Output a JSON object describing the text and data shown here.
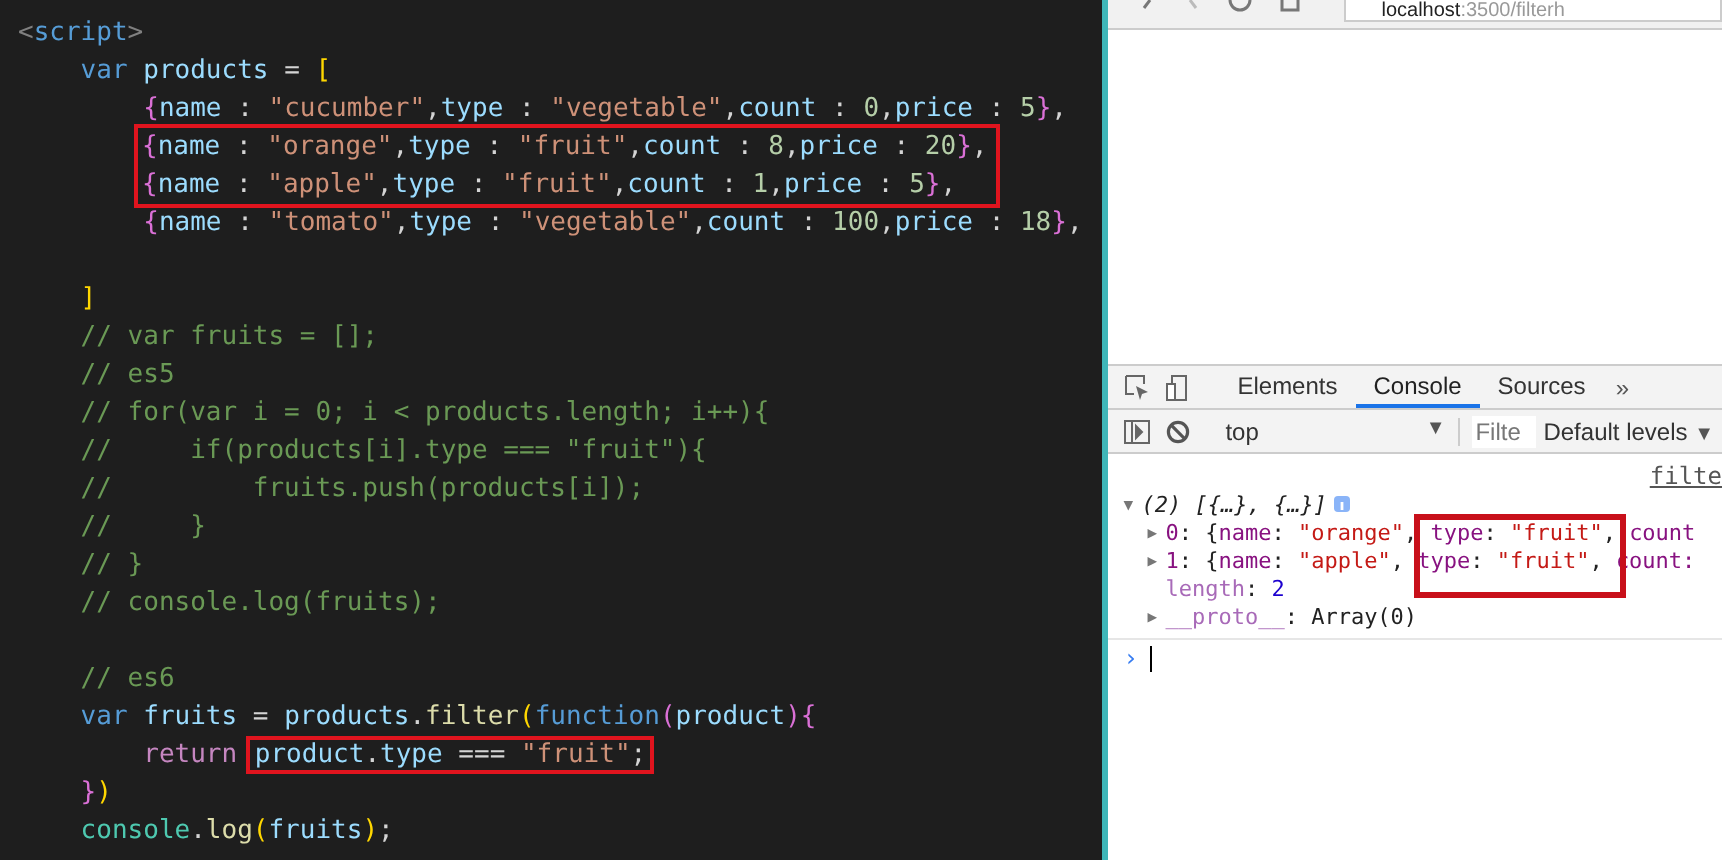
{
  "editor": {
    "lines": [
      {
        "kind": "line",
        "tokens": [
          {
            "kind": "angle",
            "text": "<"
          },
          {
            "kind": "tag",
            "text": "script"
          },
          {
            "kind": "angle",
            "text": ">"
          }
        ]
      },
      {
        "kind": "line",
        "tokens": [
          {
            "kind": "keyword",
            "text": "    var "
          },
          {
            "kind": "ident",
            "text": "products"
          },
          {
            "kind": "plain",
            "text": " = "
          },
          {
            "kind": "bracket1",
            "text": "["
          }
        ]
      },
      {
        "kind": "line",
        "tokens": [
          {
            "kind": "bracket2",
            "text": "        {"
          },
          {
            "kind": "ident",
            "text": "name"
          },
          {
            "kind": "plain",
            "text": " : "
          },
          {
            "kind": "string",
            "text": "\"cucumber\""
          },
          {
            "kind": "plain",
            "text": ","
          },
          {
            "kind": "ident",
            "text": "type"
          },
          {
            "kind": "plain",
            "text": " : "
          },
          {
            "kind": "string",
            "text": "\"vegetable\""
          },
          {
            "kind": "plain",
            "text": ","
          },
          {
            "kind": "ident",
            "text": "count"
          },
          {
            "kind": "plain",
            "text": " : "
          },
          {
            "kind": "number",
            "text": "0"
          },
          {
            "kind": "plain",
            "text": ","
          },
          {
            "kind": "ident",
            "text": "price"
          },
          {
            "kind": "plain",
            "text": " : "
          },
          {
            "kind": "number",
            "text": "5"
          },
          {
            "kind": "bracket2",
            "text": "}"
          },
          {
            "kind": "plain",
            "text": ","
          }
        ]
      },
      {
        "kind": "boxed",
        "lines": [
          {
            "tokens": [
              {
                "kind": "bracket2",
                "text": "{"
              },
              {
                "kind": "ident",
                "text": "name"
              },
              {
                "kind": "plain",
                "text": " : "
              },
              {
                "kind": "string",
                "text": "\"orange\""
              },
              {
                "kind": "plain",
                "text": ","
              },
              {
                "kind": "ident",
                "text": "type"
              },
              {
                "kind": "plain",
                "text": " : "
              },
              {
                "kind": "string",
                "text": "\"fruit\""
              },
              {
                "kind": "plain",
                "text": ","
              },
              {
                "kind": "ident",
                "text": "count"
              },
              {
                "kind": "plain",
                "text": " : "
              },
              {
                "kind": "number",
                "text": "8"
              },
              {
                "kind": "plain",
                "text": ","
              },
              {
                "kind": "ident",
                "text": "price"
              },
              {
                "kind": "plain",
                "text": " : "
              },
              {
                "kind": "number",
                "text": "20"
              },
              {
                "kind": "bracket2",
                "text": "}"
              },
              {
                "kind": "plain",
                "text": ","
              }
            ]
          },
          {
            "tokens": [
              {
                "kind": "bracket2",
                "text": "{"
              },
              {
                "kind": "ident",
                "text": "name"
              },
              {
                "kind": "plain",
                "text": " : "
              },
              {
                "kind": "string",
                "text": "\"apple\""
              },
              {
                "kind": "plain",
                "text": ","
              },
              {
                "kind": "ident",
                "text": "type"
              },
              {
                "kind": "plain",
                "text": " : "
              },
              {
                "kind": "string",
                "text": "\"fruit\""
              },
              {
                "kind": "plain",
                "text": ","
              },
              {
                "kind": "ident",
                "text": "count"
              },
              {
                "kind": "plain",
                "text": " : "
              },
              {
                "kind": "number",
                "text": "1"
              },
              {
                "kind": "plain",
                "text": ","
              },
              {
                "kind": "ident",
                "text": "price"
              },
              {
                "kind": "plain",
                "text": " : "
              },
              {
                "kind": "number",
                "text": "5"
              },
              {
                "kind": "bracket2",
                "text": "}"
              },
              {
                "kind": "plain",
                "text": ","
              }
            ]
          }
        ]
      },
      {
        "kind": "line",
        "tokens": [
          {
            "kind": "bracket2",
            "text": "        {"
          },
          {
            "kind": "ident",
            "text": "name"
          },
          {
            "kind": "plain",
            "text": " : "
          },
          {
            "kind": "string",
            "text": "\"tomato\""
          },
          {
            "kind": "plain",
            "text": ","
          },
          {
            "kind": "ident",
            "text": "type"
          },
          {
            "kind": "plain",
            "text": " : "
          },
          {
            "kind": "string",
            "text": "\"vegetable\""
          },
          {
            "kind": "plain",
            "text": ","
          },
          {
            "kind": "ident",
            "text": "count"
          },
          {
            "kind": "plain",
            "text": " : "
          },
          {
            "kind": "number",
            "text": "100"
          },
          {
            "kind": "plain",
            "text": ","
          },
          {
            "kind": "ident",
            "text": "price"
          },
          {
            "kind": "plain",
            "text": " : "
          },
          {
            "kind": "number",
            "text": "18"
          },
          {
            "kind": "bracket2",
            "text": "}"
          },
          {
            "kind": "plain",
            "text": ","
          }
        ]
      },
      {
        "kind": "line"
      },
      {
        "kind": "line",
        "tokens": [
          {
            "kind": "bracket1",
            "text": "    ]"
          }
        ]
      },
      {
        "kind": "line",
        "tokens": [
          {
            "kind": "comment",
            "text": "    // var fruits = [];"
          }
        ]
      },
      {
        "kind": "line",
        "tokens": [
          {
            "kind": "comment",
            "text": "    // es5"
          }
        ]
      },
      {
        "kind": "line",
        "tokens": [
          {
            "kind": "comment",
            "text": "    // for(var i = 0; i < products.length; i++){"
          }
        ]
      },
      {
        "kind": "line",
        "tokens": [
          {
            "kind": "comment",
            "text": "    //     if(products[i].type === \"fruit\"){"
          }
        ]
      },
      {
        "kind": "line",
        "tokens": [
          {
            "kind": "comment",
            "text": "    //         fruits.push(products[i]);"
          }
        ]
      },
      {
        "kind": "line",
        "tokens": [
          {
            "kind": "comment",
            "text": "    //     }"
          }
        ]
      },
      {
        "kind": "line",
        "tokens": [
          {
            "kind": "comment",
            "text": "    // }"
          }
        ]
      },
      {
        "kind": "line",
        "tokens": [
          {
            "kind": "comment",
            "text": "    // console.log(fruits);"
          }
        ]
      },
      {
        "kind": "line"
      },
      {
        "kind": "line",
        "tokens": [
          {
            "kind": "comment",
            "text": "    // es6"
          }
        ]
      },
      {
        "kind": "line",
        "tokens": [
          {
            "kind": "keyword",
            "text": "    var "
          },
          {
            "kind": "ident",
            "text": "fruits"
          },
          {
            "kind": "plain",
            "text": " = "
          },
          {
            "kind": "ident",
            "text": "products"
          },
          {
            "kind": "plain",
            "text": "."
          },
          {
            "kind": "function",
            "text": "filter"
          },
          {
            "kind": "bracket1",
            "text": "("
          },
          {
            "kind": "keyword",
            "text": "function"
          },
          {
            "kind": "bracket2",
            "text": "("
          },
          {
            "kind": "ident",
            "text": "product"
          },
          {
            "kind": "bracket2",
            "text": ")"
          },
          {
            "kind": "bracket2",
            "text": "{"
          }
        ]
      },
      {
        "kind": "line",
        "tokens": [
          {
            "kind": "control",
            "text": "        return "
          },
          {
            "kind": "box",
            "tokens": [
              {
                "kind": "ident",
                "text": "product"
              },
              {
                "kind": "plain",
                "text": "."
              },
              {
                "kind": "ident",
                "text": "type"
              },
              {
                "kind": "plain",
                "text": " === "
              },
              {
                "kind": "string",
                "text": "\"fruit\""
              },
              {
                "kind": "plain",
                "text": ";"
              }
            ]
          }
        ]
      },
      {
        "kind": "line",
        "tokens": [
          {
            "kind": "bracket2",
            "text": "    }"
          },
          {
            "kind": "bracket1",
            "text": ")"
          }
        ]
      },
      {
        "kind": "line",
        "tokens": [
          {
            "kind": "class",
            "text": "    console"
          },
          {
            "kind": "plain",
            "text": "."
          },
          {
            "kind": "function",
            "text": "log"
          },
          {
            "kind": "bracket1",
            "text": "("
          },
          {
            "kind": "ident",
            "text": "fruits"
          },
          {
            "kind": "bracket1",
            "text": ")"
          },
          {
            "kind": "plain",
            "text": ";"
          }
        ]
      }
    ]
  },
  "browser": {
    "url_host": "localhost",
    "url_rest": ":3500/filterh"
  },
  "devtools": {
    "tabs": [
      {
        "label": "Elements",
        "selected": false
      },
      {
        "label": "Console",
        "selected": true
      },
      {
        "label": "Sources",
        "selected": false
      }
    ],
    "more": "»",
    "context": "top",
    "context_arrow": "▼",
    "filter_placeholder": "Filte",
    "levels": "Default levels",
    "levels_arrow": "▼",
    "source_link": "filte",
    "rows": [
      {
        "arrow": "▼",
        "tokens": [
          {
            "kind": "summary",
            "text": "(2) [{…}, {…}]"
          }
        ],
        "info": true
      },
      {
        "arrow": "▶",
        "tokens": [
          {
            "kind": "index",
            "text": "0"
          },
          {
            "kind": "plain",
            "text": ": {"
          },
          {
            "kind": "key",
            "text": "name"
          },
          {
            "kind": "plain",
            "text": ": "
          },
          {
            "kind": "string",
            "text": "\"orange\""
          },
          {
            "kind": "plain",
            "text": ", "
          },
          {
            "kind": "key",
            "text": "type"
          },
          {
            "kind": "plain",
            "text": ": "
          },
          {
            "kind": "string",
            "text": "\"fruit\""
          },
          {
            "kind": "plain",
            "text": ", "
          },
          {
            "kind": "key",
            "text": "count"
          }
        ]
      },
      {
        "arrow": "▶",
        "tokens": [
          {
            "kind": "index",
            "text": "1"
          },
          {
            "kind": "plain",
            "text": ": {"
          },
          {
            "kind": "key",
            "text": "name"
          },
          {
            "kind": "plain",
            "text": ": "
          },
          {
            "kind": "string",
            "text": "\"apple\""
          },
          {
            "kind": "plain",
            "text": ", "
          },
          {
            "kind": "key",
            "text": "type"
          },
          {
            "kind": "plain",
            "text": ": "
          },
          {
            "kind": "string",
            "text": "\"fruit\""
          },
          {
            "kind": "plain",
            "text": ", "
          },
          {
            "kind": "key",
            "text": "count:"
          }
        ]
      },
      {
        "tokens": [
          {
            "kind": "dimkey",
            "text": "length"
          },
          {
            "kind": "plain",
            "text": ": "
          },
          {
            "kind": "num",
            "text": "2"
          }
        ]
      },
      {
        "arrow": "▶",
        "tokens": [
          {
            "kind": "dimkey",
            "text": "__proto__"
          },
          {
            "kind": "plain",
            "text": ": Array(0)"
          }
        ]
      }
    ],
    "prompt": "›"
  }
}
